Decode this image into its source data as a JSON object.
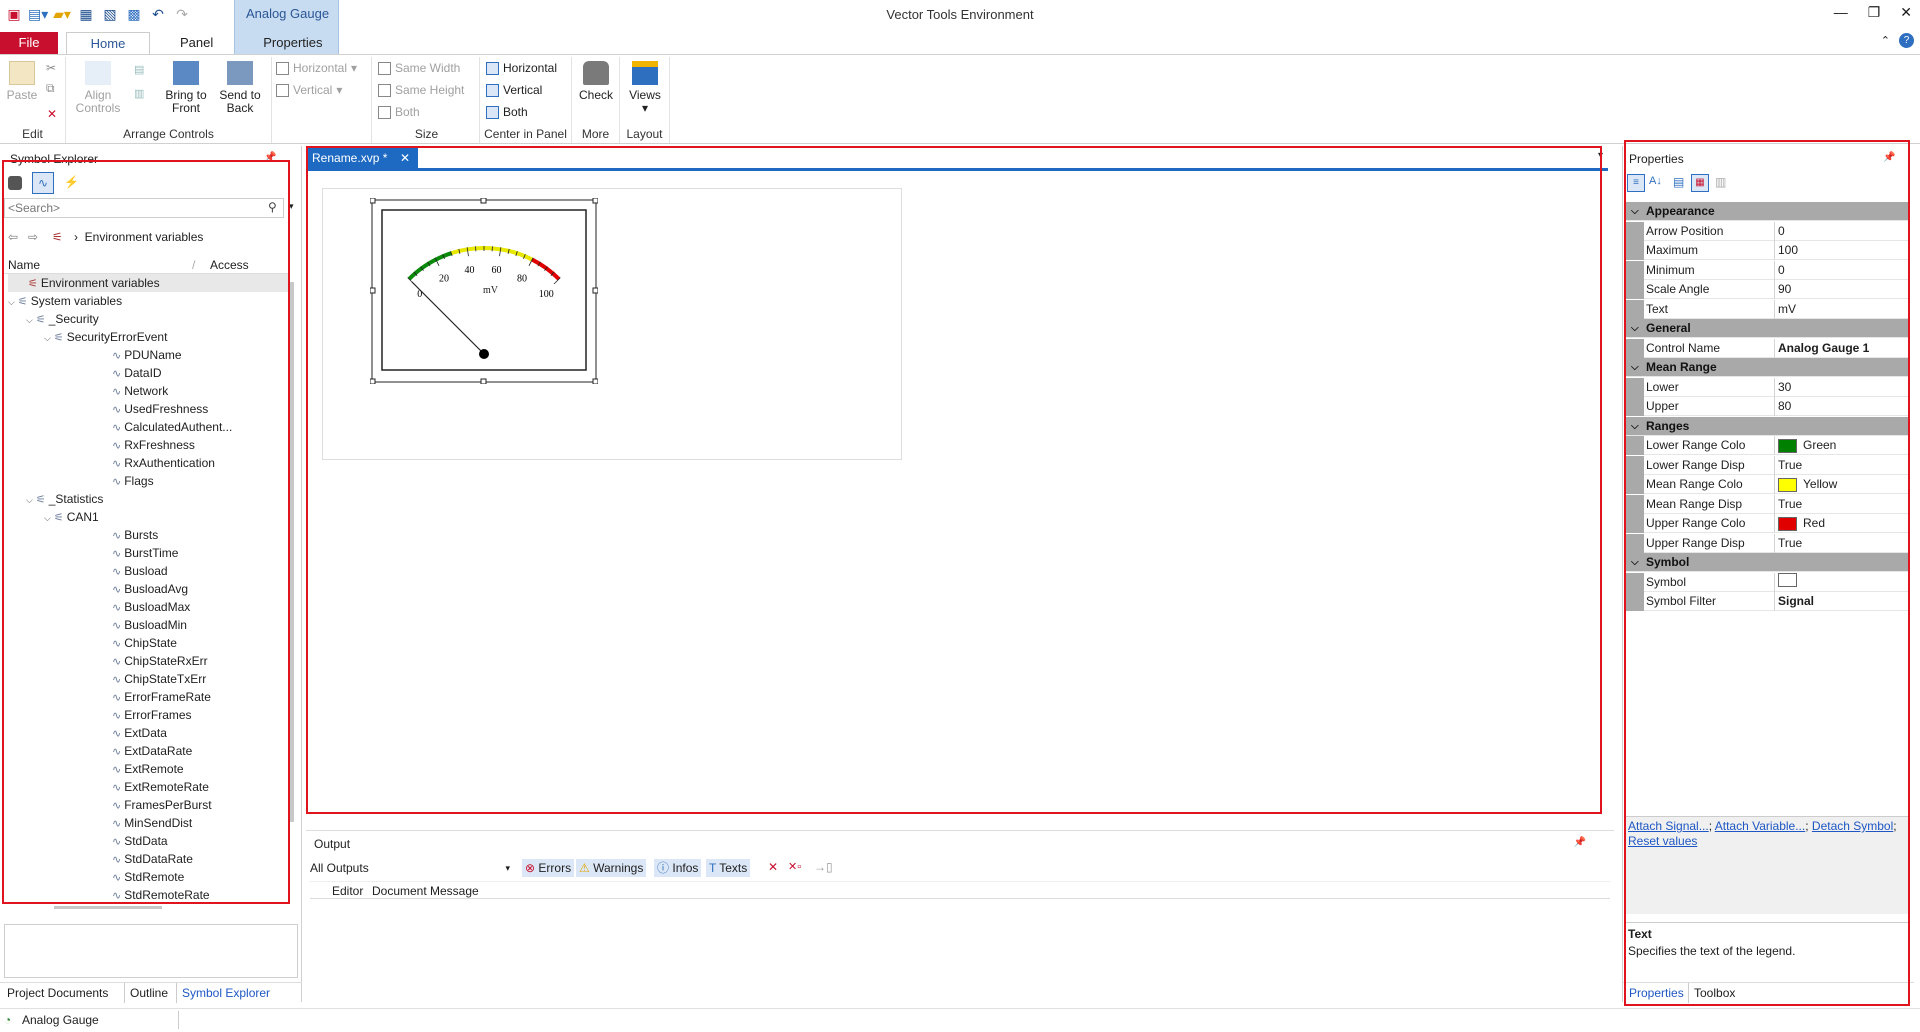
{
  "window": {
    "title": "Vector Tools Environment",
    "context_tab": "Analog Gauge"
  },
  "ribbon": {
    "tabs": [
      "File",
      "Home",
      "Panel",
      "Properties"
    ],
    "edit": {
      "paste": "Paste",
      "group": "Edit"
    },
    "arrange": {
      "align": "Align Controls",
      "bring": "Bring to Front",
      "send": "Send to Back",
      "group": "Arrange Controls",
      "horizontal": "Horizontal",
      "vertical": "Vertical"
    },
    "size": {
      "same_width": "Same Width",
      "same_height": "Same Height",
      "both": "Both",
      "group": "Size"
    },
    "center": {
      "horizontal": "Horizontal",
      "vertical": "Vertical",
      "both": "Both",
      "group": "Center in Panel"
    },
    "more": {
      "check": "Check",
      "group": "More"
    },
    "layout": {
      "views": "Views",
      "group": "Layout"
    }
  },
  "symbol_explorer": {
    "title": "Symbol Explorer",
    "search_placeholder": "<Search>",
    "breadcrumb": "Environment variables",
    "col_name": "Name",
    "col_access": "Access",
    "rows": [
      {
        "label": "Environment variables",
        "indent": 0,
        "icon": "env"
      },
      {
        "label": "System variables",
        "indent": 0,
        "icon": "exp"
      },
      {
        "label": "_Security",
        "indent": 1,
        "icon": "ns"
      },
      {
        "label": "SecurityErrorEvent",
        "indent": 2,
        "icon": "ns"
      },
      {
        "label": "PDUName",
        "indent": 3,
        "icon": "sig"
      },
      {
        "label": "DataID",
        "indent": 3,
        "icon": "sig"
      },
      {
        "label": "Network",
        "indent": 3,
        "icon": "sig"
      },
      {
        "label": "UsedFreshness",
        "indent": 3,
        "icon": "sig"
      },
      {
        "label": "CalculatedAuthent...",
        "indent": 3,
        "icon": "sig"
      },
      {
        "label": "RxFreshness",
        "indent": 3,
        "icon": "sig"
      },
      {
        "label": "RxAuthentication",
        "indent": 3,
        "icon": "sig"
      },
      {
        "label": "Flags",
        "indent": 3,
        "icon": "sig"
      },
      {
        "label": "_Statistics",
        "indent": 1,
        "icon": "ns"
      },
      {
        "label": "CAN1",
        "indent": 2,
        "icon": "ns"
      },
      {
        "label": "Bursts",
        "indent": 3,
        "icon": "sig"
      },
      {
        "label": "BurstTime",
        "indent": 3,
        "icon": "sig"
      },
      {
        "label": "Busload",
        "indent": 3,
        "icon": "sig"
      },
      {
        "label": "BusloadAvg",
        "indent": 3,
        "icon": "sig"
      },
      {
        "label": "BusloadMax",
        "indent": 3,
        "icon": "sig"
      },
      {
        "label": "BusloadMin",
        "indent": 3,
        "icon": "sig"
      },
      {
        "label": "ChipState",
        "indent": 3,
        "icon": "sig"
      },
      {
        "label": "ChipStateRxErr",
        "indent": 3,
        "icon": "sig"
      },
      {
        "label": "ChipStateTxErr",
        "indent": 3,
        "icon": "sig"
      },
      {
        "label": "ErrorFrameRate",
        "indent": 3,
        "icon": "sig"
      },
      {
        "label": "ErrorFrames",
        "indent": 3,
        "icon": "sig"
      },
      {
        "label": "ExtData",
        "indent": 3,
        "icon": "sig"
      },
      {
        "label": "ExtDataRate",
        "indent": 3,
        "icon": "sig"
      },
      {
        "label": "ExtRemote",
        "indent": 3,
        "icon": "sig"
      },
      {
        "label": "ExtRemoteRate",
        "indent": 3,
        "icon": "sig"
      },
      {
        "label": "FramesPerBurst",
        "indent": 3,
        "icon": "sig"
      },
      {
        "label": "MinSendDist",
        "indent": 3,
        "icon": "sig"
      },
      {
        "label": "StdData",
        "indent": 3,
        "icon": "sig"
      },
      {
        "label": "StdDataRate",
        "indent": 3,
        "icon": "sig"
      },
      {
        "label": "StdRemote",
        "indent": 3,
        "icon": "sig"
      },
      {
        "label": "StdRemoteRate",
        "indent": 3,
        "icon": "sig"
      }
    ],
    "bottom_tabs": [
      "Project Documents",
      "Outline",
      "Symbol Explorer"
    ]
  },
  "document": {
    "tab": "Rename.xvp *",
    "gauge": {
      "ticks": [
        "0",
        "20",
        "40",
        "60",
        "80",
        "100"
      ],
      "unit": "mV",
      "scale_angle": 90,
      "arrow_position": 0,
      "min": 0,
      "max": 100
    }
  },
  "output": {
    "title": "Output",
    "filter": "All Outputs",
    "buttons": {
      "errors": "Errors",
      "warnings": "Warnings",
      "infos": "Infos",
      "texts": "Texts"
    },
    "columns": [
      "Editor",
      "Document",
      "Message"
    ]
  },
  "properties": {
    "title": "Properties",
    "rows": [
      {
        "type": "cat",
        "k": "Appearance"
      },
      {
        "k": "Arrow Position",
        "v": "0"
      },
      {
        "k": "Maximum",
        "v": "100"
      },
      {
        "k": "Minimum",
        "v": "0"
      },
      {
        "k": "Scale Angle",
        "v": "90"
      },
      {
        "k": "Text",
        "v": "mV"
      },
      {
        "type": "cat",
        "k": "General"
      },
      {
        "k": "Control Name",
        "v": "Analog Gauge 1",
        "bold": true
      },
      {
        "type": "cat",
        "k": "Mean Range"
      },
      {
        "k": "Lower",
        "v": "30"
      },
      {
        "k": "Upper",
        "v": "80"
      },
      {
        "type": "cat",
        "k": "Ranges"
      },
      {
        "k": "Lower Range Colo",
        "v": "Green",
        "color": "#008000"
      },
      {
        "k": "Lower Range Disp",
        "v": "True"
      },
      {
        "k": "Mean Range Colo",
        "v": "Yellow",
        "color": "#ffff00"
      },
      {
        "k": "Mean Range Disp",
        "v": "True"
      },
      {
        "k": "Upper Range Colo",
        "v": "Red",
        "color": "#e00000"
      },
      {
        "k": "Upper Range Disp",
        "v": "True"
      },
      {
        "type": "cat",
        "k": "Symbol"
      },
      {
        "k": "Symbol",
        "v": "",
        "color": "#ffffff"
      },
      {
        "k": "Symbol Filter",
        "v": "Signal",
        "bold": true
      }
    ],
    "links": {
      "attach_signal": "Attach Signal...",
      "attach_variable": "Attach Variable...",
      "detach_symbol": "Detach Symbol",
      "reset": "Reset values"
    },
    "help_title": "Text",
    "help_text": "Specifies the text of the legend.",
    "bottom_tabs": [
      "Properties",
      "Toolbox"
    ]
  },
  "statusbar": {
    "text": "Analog Gauge"
  }
}
